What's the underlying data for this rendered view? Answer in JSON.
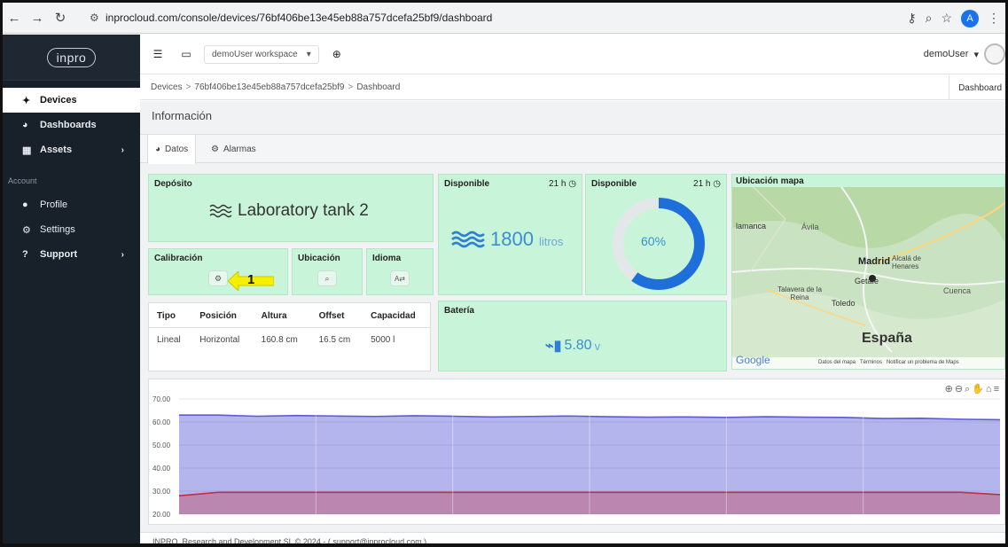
{
  "browser": {
    "url": "inprocloud.com/console/devices/76bf406be13e45eb88a757dcefa25bf9/dashboard",
    "avatar_letter": "A"
  },
  "sidebar": {
    "logo": "inpro",
    "items": [
      {
        "label": "Devices",
        "icon": "plug-icon"
      },
      {
        "label": "Dashboards",
        "icon": "tachometer-icon"
      },
      {
        "label": "Assets",
        "icon": "building-icon"
      }
    ],
    "account_section": "Account",
    "account_items": [
      {
        "label": "Profile",
        "icon": "user-icon"
      },
      {
        "label": "Settings",
        "icon": "gears-icon"
      },
      {
        "label": "Support",
        "icon": "question-icon"
      }
    ]
  },
  "topbar": {
    "workspace": "demoUser workspace",
    "user": "demoUser"
  },
  "breadcrumb": {
    "items": [
      "Devices",
      "76bf406be13e45eb88a757dcefa25bf9",
      "Dashboard"
    ],
    "right_tab": "Dashboard"
  },
  "section_title": "Información",
  "tabs": [
    {
      "label": "Datos"
    },
    {
      "label": "Alarmas"
    }
  ],
  "cards": {
    "deposito": {
      "title": "Depósito",
      "value": "Laboratory tank 2"
    },
    "disponible1": {
      "title": "Disponible",
      "meta": "21 h",
      "value": "1800",
      "unit": "litros"
    },
    "disponible2": {
      "title": "Disponible",
      "meta": "21 h",
      "percent_label": "60%",
      "percent": 0.6
    },
    "mapa": {
      "title": "Ubicación mapa"
    },
    "calibracion": {
      "title": "Calibración"
    },
    "ubicacion": {
      "title": "Ubicación"
    },
    "idioma": {
      "title": "Idioma"
    },
    "bateria": {
      "title": "Batería",
      "value": "5.80",
      "unit": "v"
    }
  },
  "annotation": {
    "number": "1"
  },
  "table": {
    "headers": [
      "Tipo",
      "Posición",
      "Altura",
      "Offset",
      "Capacidad"
    ],
    "rows": [
      [
        "Lineal",
        "Horizontal",
        "160.8 cm",
        "16.5 cm",
        "5000 l"
      ]
    ]
  },
  "map_labels": {
    "city1": "lamanca",
    "city2": "Madrid",
    "city3": "Alcalá de Henares",
    "city4": "Getafe",
    "city5": "Talavera de la Reina",
    "city6": "Toledo",
    "city7": "Cuenca",
    "city8": "Ávila",
    "country": "España",
    "google": "Google",
    "footer1": "Datos del mapa",
    "footer2": "Términos",
    "footer3": "Notificar un problema de Maps"
  },
  "chart_data": {
    "type": "area",
    "yticks": [
      "70.00",
      "60.00",
      "50.00",
      "40.00",
      "30.00",
      "20.00"
    ],
    "ylim": [
      20,
      70
    ],
    "series": [
      {
        "color": "#5b5bd8",
        "values": [
          63,
          63,
          62.5,
          62.8,
          62.6,
          62.4,
          62.7,
          62.5,
          62.2,
          62.4,
          62.6,
          62.3,
          62.1,
          62.2,
          62,
          62.3,
          62.1,
          62,
          61.5,
          61.6,
          61.2,
          61
        ]
      },
      {
        "color": "#c03040",
        "values": [
          28,
          29.5,
          29.5,
          29.5,
          29.5,
          29.5,
          29.5,
          29.5,
          29.5,
          29.5,
          29.5,
          29.5,
          29.5,
          29.5,
          29.5,
          29.5,
          29.5,
          29.5,
          29.5,
          29.5,
          29.5,
          28.5
        ]
      }
    ]
  },
  "footer": "INPRO, Research and Development SL © 2024 - ( support@inprocloud.com )"
}
